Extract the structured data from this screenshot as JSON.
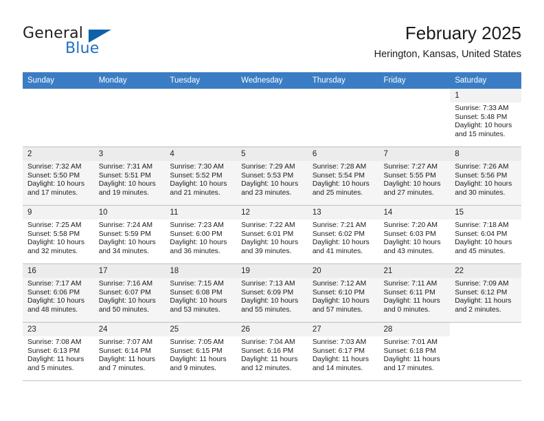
{
  "brand": {
    "name_part1": "General",
    "name_part2": "Blue",
    "logo_icon": "triangle-icon"
  },
  "header": {
    "title": "February 2025",
    "location": "Herington, Kansas, United States"
  },
  "colors": {
    "header_row_background": "#3b7dc4",
    "header_row_text": "#ffffff",
    "alt_row_background": "#f5f5f5",
    "day_number_background": "#f2f2f2",
    "brand_blue": "#1f6fc4",
    "brand_dark": "#231f20",
    "cell_border": "#bfbfbf"
  },
  "calendar": {
    "weekday_headers": [
      "Sunday",
      "Monday",
      "Tuesday",
      "Wednesday",
      "Thursday",
      "Friday",
      "Saturday"
    ],
    "labels": {
      "sunrise": "Sunrise:",
      "sunset": "Sunset:",
      "daylight": "Daylight:"
    },
    "weeks": [
      [
        {
          "day": "",
          "empty": true
        },
        {
          "day": "",
          "empty": true
        },
        {
          "day": "",
          "empty": true
        },
        {
          "day": "",
          "empty": true
        },
        {
          "day": "",
          "empty": true
        },
        {
          "day": "",
          "empty": true
        },
        {
          "day": "1",
          "sunrise": "Sunrise: 7:33 AM",
          "sunset": "Sunset: 5:48 PM",
          "daylight_line1": "Daylight: 10 hours",
          "daylight_line2": "and 15 minutes."
        }
      ],
      [
        {
          "day": "2",
          "sunrise": "Sunrise: 7:32 AM",
          "sunset": "Sunset: 5:50 PM",
          "daylight_line1": "Daylight: 10 hours",
          "daylight_line2": "and 17 minutes."
        },
        {
          "day": "3",
          "sunrise": "Sunrise: 7:31 AM",
          "sunset": "Sunset: 5:51 PM",
          "daylight_line1": "Daylight: 10 hours",
          "daylight_line2": "and 19 minutes."
        },
        {
          "day": "4",
          "sunrise": "Sunrise: 7:30 AM",
          "sunset": "Sunset: 5:52 PM",
          "daylight_line1": "Daylight: 10 hours",
          "daylight_line2": "and 21 minutes."
        },
        {
          "day": "5",
          "sunrise": "Sunrise: 7:29 AM",
          "sunset": "Sunset: 5:53 PM",
          "daylight_line1": "Daylight: 10 hours",
          "daylight_line2": "and 23 minutes."
        },
        {
          "day": "6",
          "sunrise": "Sunrise: 7:28 AM",
          "sunset": "Sunset: 5:54 PM",
          "daylight_line1": "Daylight: 10 hours",
          "daylight_line2": "and 25 minutes."
        },
        {
          "day": "7",
          "sunrise": "Sunrise: 7:27 AM",
          "sunset": "Sunset: 5:55 PM",
          "daylight_line1": "Daylight: 10 hours",
          "daylight_line2": "and 27 minutes."
        },
        {
          "day": "8",
          "sunrise": "Sunrise: 7:26 AM",
          "sunset": "Sunset: 5:56 PM",
          "daylight_line1": "Daylight: 10 hours",
          "daylight_line2": "and 30 minutes."
        }
      ],
      [
        {
          "day": "9",
          "sunrise": "Sunrise: 7:25 AM",
          "sunset": "Sunset: 5:58 PM",
          "daylight_line1": "Daylight: 10 hours",
          "daylight_line2": "and 32 minutes."
        },
        {
          "day": "10",
          "sunrise": "Sunrise: 7:24 AM",
          "sunset": "Sunset: 5:59 PM",
          "daylight_line1": "Daylight: 10 hours",
          "daylight_line2": "and 34 minutes."
        },
        {
          "day": "11",
          "sunrise": "Sunrise: 7:23 AM",
          "sunset": "Sunset: 6:00 PM",
          "daylight_line1": "Daylight: 10 hours",
          "daylight_line2": "and 36 minutes."
        },
        {
          "day": "12",
          "sunrise": "Sunrise: 7:22 AM",
          "sunset": "Sunset: 6:01 PM",
          "daylight_line1": "Daylight: 10 hours",
          "daylight_line2": "and 39 minutes."
        },
        {
          "day": "13",
          "sunrise": "Sunrise: 7:21 AM",
          "sunset": "Sunset: 6:02 PM",
          "daylight_line1": "Daylight: 10 hours",
          "daylight_line2": "and 41 minutes."
        },
        {
          "day": "14",
          "sunrise": "Sunrise: 7:20 AM",
          "sunset": "Sunset: 6:03 PM",
          "daylight_line1": "Daylight: 10 hours",
          "daylight_line2": "and 43 minutes."
        },
        {
          "day": "15",
          "sunrise": "Sunrise: 7:18 AM",
          "sunset": "Sunset: 6:04 PM",
          "daylight_line1": "Daylight: 10 hours",
          "daylight_line2": "and 45 minutes."
        }
      ],
      [
        {
          "day": "16",
          "sunrise": "Sunrise: 7:17 AM",
          "sunset": "Sunset: 6:06 PM",
          "daylight_line1": "Daylight: 10 hours",
          "daylight_line2": "and 48 minutes."
        },
        {
          "day": "17",
          "sunrise": "Sunrise: 7:16 AM",
          "sunset": "Sunset: 6:07 PM",
          "daylight_line1": "Daylight: 10 hours",
          "daylight_line2": "and 50 minutes."
        },
        {
          "day": "18",
          "sunrise": "Sunrise: 7:15 AM",
          "sunset": "Sunset: 6:08 PM",
          "daylight_line1": "Daylight: 10 hours",
          "daylight_line2": "and 53 minutes."
        },
        {
          "day": "19",
          "sunrise": "Sunrise: 7:13 AM",
          "sunset": "Sunset: 6:09 PM",
          "daylight_line1": "Daylight: 10 hours",
          "daylight_line2": "and 55 minutes."
        },
        {
          "day": "20",
          "sunrise": "Sunrise: 7:12 AM",
          "sunset": "Sunset: 6:10 PM",
          "daylight_line1": "Daylight: 10 hours",
          "daylight_line2": "and 57 minutes."
        },
        {
          "day": "21",
          "sunrise": "Sunrise: 7:11 AM",
          "sunset": "Sunset: 6:11 PM",
          "daylight_line1": "Daylight: 11 hours",
          "daylight_line2": "and 0 minutes."
        },
        {
          "day": "22",
          "sunrise": "Sunrise: 7:09 AM",
          "sunset": "Sunset: 6:12 PM",
          "daylight_line1": "Daylight: 11 hours",
          "daylight_line2": "and 2 minutes."
        }
      ],
      [
        {
          "day": "23",
          "sunrise": "Sunrise: 7:08 AM",
          "sunset": "Sunset: 6:13 PM",
          "daylight_line1": "Daylight: 11 hours",
          "daylight_line2": "and 5 minutes."
        },
        {
          "day": "24",
          "sunrise": "Sunrise: 7:07 AM",
          "sunset": "Sunset: 6:14 PM",
          "daylight_line1": "Daylight: 11 hours",
          "daylight_line2": "and 7 minutes."
        },
        {
          "day": "25",
          "sunrise": "Sunrise: 7:05 AM",
          "sunset": "Sunset: 6:15 PM",
          "daylight_line1": "Daylight: 11 hours",
          "daylight_line2": "and 9 minutes."
        },
        {
          "day": "26",
          "sunrise": "Sunrise: 7:04 AM",
          "sunset": "Sunset: 6:16 PM",
          "daylight_line1": "Daylight: 11 hours",
          "daylight_line2": "and 12 minutes."
        },
        {
          "day": "27",
          "sunrise": "Sunrise: 7:03 AM",
          "sunset": "Sunset: 6:17 PM",
          "daylight_line1": "Daylight: 11 hours",
          "daylight_line2": "and 14 minutes."
        },
        {
          "day": "28",
          "sunrise": "Sunrise: 7:01 AM",
          "sunset": "Sunset: 6:18 PM",
          "daylight_line1": "Daylight: 11 hours",
          "daylight_line2": "and 17 minutes."
        },
        {
          "day": "",
          "empty": true
        }
      ]
    ]
  }
}
